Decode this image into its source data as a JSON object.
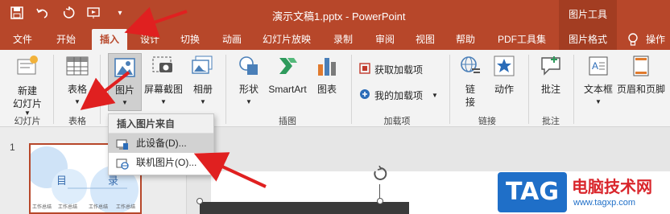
{
  "window": {
    "document_title": "演示文稿1.pptx  -  PowerPoint",
    "context_group": "图片工具"
  },
  "tabs": [
    "文件",
    "开始",
    "插入",
    "设计",
    "切换",
    "动画",
    "幻灯片放映",
    "录制",
    "审阅",
    "视图",
    "帮助",
    "PDF工具集",
    "图片格式"
  ],
  "active_tab": "插入",
  "ribbon": {
    "new_slide": "新建\n幻灯片",
    "new_slide_line1": "新建",
    "new_slide_line2": "幻灯片",
    "group_slides": "幻灯片",
    "table": "表格",
    "group_table": "表格",
    "picture": "图片",
    "screenshot": "屏幕截图",
    "album": "相册",
    "shapes": "形状",
    "smartart": "SmartArt",
    "chart": "图表",
    "group_illustrations": "插图",
    "get_addins": "获取加载项",
    "my_addins": "我的加载项",
    "group_addins": "加载项",
    "link": "链\n接",
    "link_line1": "链",
    "link_line2": "接",
    "action": "动作",
    "group_links": "链接",
    "comment": "批注",
    "group_comments": "批注",
    "textbox": "文本框",
    "header_footer": "页眉和页脚"
  },
  "dropdown": {
    "header": "插入图片来自",
    "items": [
      "此设备(D)...",
      "联机图片(O)..."
    ]
  },
  "slides": {
    "number": "1",
    "thumb_title_a": "目",
    "thumb_title_b": "录",
    "thumb_footer": [
      "工作总结",
      "工作总结",
      "工作总结",
      "工作总结"
    ]
  },
  "watermark": {
    "logo": "TAG",
    "title": "电脑技术网",
    "url": "www.tagxp.com"
  },
  "colors": {
    "brand": "#b7472a",
    "annotation_arrow": "#e02020",
    "watermark_blue": "#1f6fc8",
    "watermark_red": "#d9262c"
  }
}
